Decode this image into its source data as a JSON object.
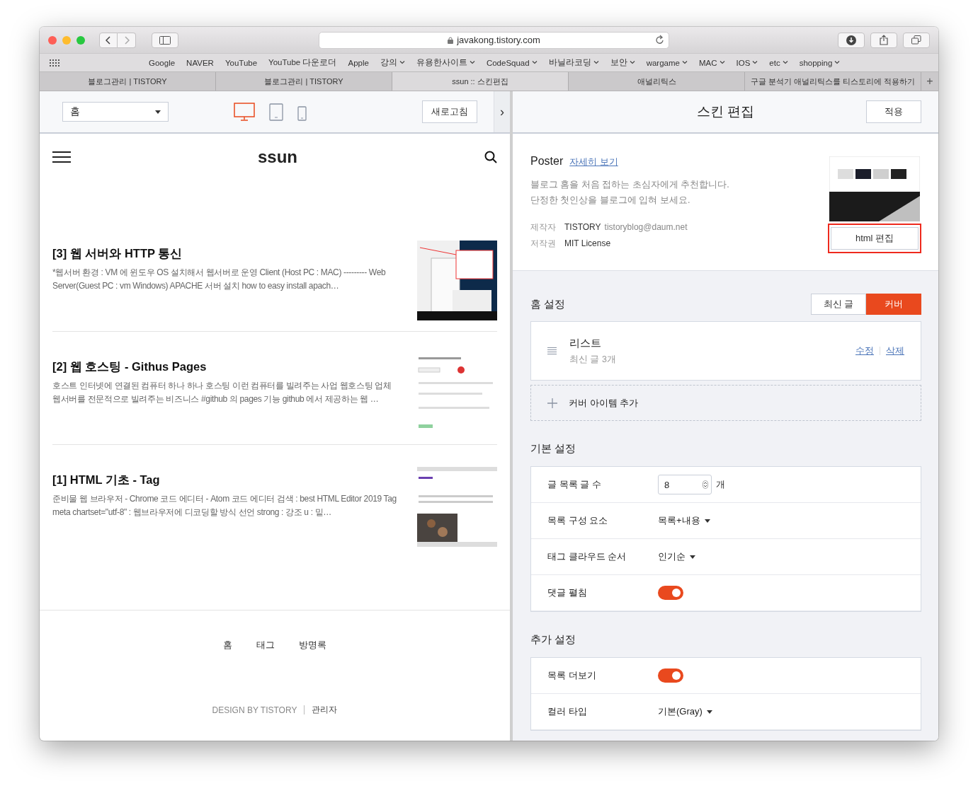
{
  "browser": {
    "url": "javakong.tistory.com",
    "bookmarks": [
      {
        "label": "Google",
        "menu": false
      },
      {
        "label": "NAVER",
        "menu": false
      },
      {
        "label": "YouTube",
        "menu": false
      },
      {
        "label": "YouTube 다운로더",
        "menu": false
      },
      {
        "label": "Apple",
        "menu": false
      },
      {
        "label": "강의",
        "menu": true
      },
      {
        "label": "유용한사이트",
        "menu": true
      },
      {
        "label": "CodeSquad",
        "menu": true
      },
      {
        "label": "바닐라코딩",
        "menu": true
      },
      {
        "label": "보안",
        "menu": true
      },
      {
        "label": "wargame",
        "menu": true
      },
      {
        "label": "MAC",
        "menu": true
      },
      {
        "label": "IOS",
        "menu": true
      },
      {
        "label": "etc",
        "menu": true
      },
      {
        "label": "shopping",
        "menu": true
      }
    ],
    "tabs": [
      {
        "label": "블로그관리 | TISTORY",
        "selected": false
      },
      {
        "label": "블로그관리 | TISTORY",
        "selected": false
      },
      {
        "label": "ssun :: 스킨편집",
        "selected": true
      },
      {
        "label": "애널리틱스",
        "selected": false
      },
      {
        "label": "구글 분석기 애널리틱스를 티스토리에 적용하기",
        "selected": false
      }
    ],
    "new_tab": "+"
  },
  "preview": {
    "page_select": "홈",
    "refresh_button": "새로고침",
    "collapse": "›",
    "devices": [
      {
        "kind": "desktop",
        "selected": true
      },
      {
        "kind": "tablet",
        "selected": false
      },
      {
        "kind": "phone",
        "selected": false
      }
    ],
    "blog_title": "ssun",
    "posts": [
      {
        "title": "[3] 웹 서버와 HTTP 통신",
        "excerpt": "*웹서버 환경 : VM 에 윈도우 OS 설치해서 웹서버로 운영 Client (Host PC : MAC) --------- Web Server(Guest PC : vm Windows) APACHE 서버 설치 how to easy install apach…"
      },
      {
        "title": "[2] 웹 호스팅 - Githus Pages",
        "excerpt": "호스트 인터넷에 연결된 컴퓨터 하나 하나 호스팅 이런 컴퓨터를 빌려주는 사업 웹호스팅 업체 웹서버를 전문적으로 빌려주는 비즈니스 #github 의 pages 기능 github 에서 제공하는 웹 …"
      },
      {
        "title": "[1] HTML 기초 - Tag",
        "excerpt": "준비물 웹 브라우저 - Chrome 코드 에디터 - Atom 코드 에디터 검색 : best HTML Editor 2019 Tag meta chartset=\"utf-8\" : 웹브라우저에 디코딩할 방식 선언 strong : 강조 u : 밑…"
      }
    ],
    "footer_nav": [
      "홈",
      "태그",
      "방명록"
    ],
    "credit": "DESIGN BY TISTORY",
    "admin_link": "관리자"
  },
  "editor": {
    "title": "스킨 편집",
    "apply_button": "적용",
    "skin": {
      "name": "Poster",
      "details_link": "자세히 보기",
      "description": [
        "블로그 홈을 처음 접하는 초심자에게 추천합니다.",
        "단정한 첫인상을 블로그에 입혀 보세요."
      ],
      "maker_label": "제작자",
      "maker": "TISTORY",
      "maker_email": "tistoryblog@daum.net",
      "license_label": "저작권",
      "license": "MIT License",
      "html_button": "html 편집",
      "html_button_highlighted": true
    },
    "home": {
      "title": "홈 설정",
      "modes": [
        {
          "label": "최신 글",
          "selected": false
        },
        {
          "label": "커버",
          "selected": true
        }
      ],
      "items": [
        {
          "name": "리스트",
          "detail": "최신 글 3개",
          "edit": "수정",
          "delete": "삭제"
        }
      ],
      "add_item": "커버 아이템 추가"
    },
    "sections": [
      {
        "title": "기본 설정",
        "rows": [
          {
            "kind": "number",
            "label": "글 목록 글 수",
            "value": "8",
            "unit": "개"
          },
          {
            "kind": "select",
            "label": "목록 구성 요소",
            "value": "목록+내용"
          },
          {
            "kind": "select",
            "label": "태그 클라우드 순서",
            "value": "인기순"
          },
          {
            "kind": "toggle",
            "label": "댓글 펼침",
            "on": true
          }
        ]
      },
      {
        "title": "추가 설정",
        "rows": [
          {
            "kind": "toggle",
            "label": "목록 더보기",
            "on": true
          },
          {
            "kind": "select",
            "label": "컬러 타입",
            "value": "기본(Gray)"
          }
        ]
      }
    ]
  }
}
